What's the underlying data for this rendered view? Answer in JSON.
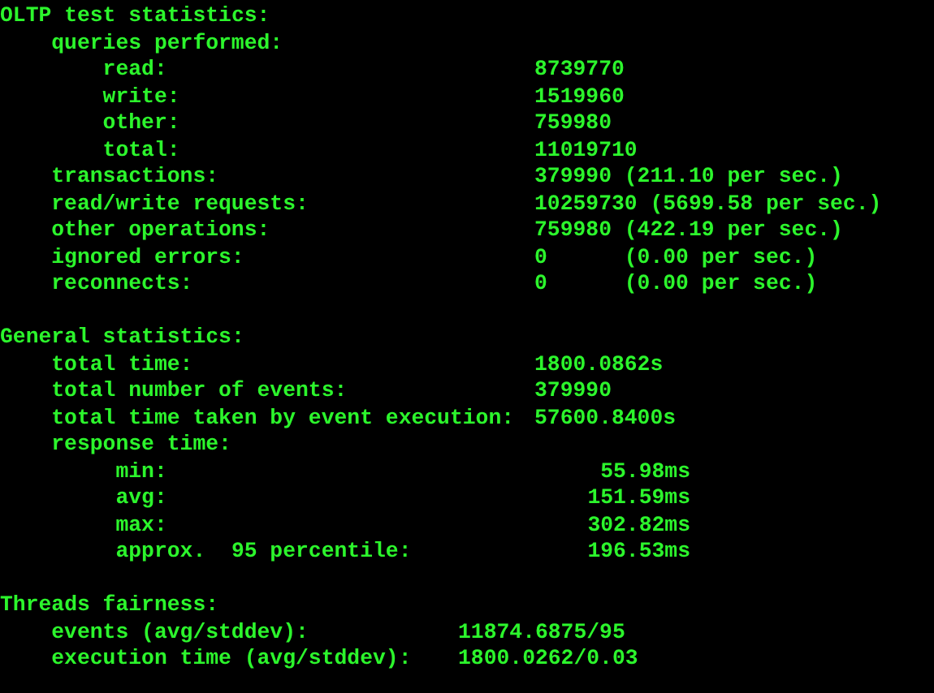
{
  "sections": [
    {
      "kind": "oltp",
      "title": "OLTP test statistics:",
      "items": [
        {
          "label": "queries performed:",
          "children": [
            {
              "label": "read:",
              "value": "8739770"
            },
            {
              "label": "write:",
              "value": "1519960"
            },
            {
              "label": "other:",
              "value": "759980"
            },
            {
              "label": "total:",
              "value": "11019710"
            }
          ]
        },
        {
          "label": "transactions:",
          "value": "379990 (211.10 per sec.)"
        },
        {
          "label": "read/write requests:",
          "value": "10259730 (5699.58 per sec.)"
        },
        {
          "label": "other operations:",
          "value": "759980 (422.19 per sec.)"
        },
        {
          "label": "ignored errors:",
          "value": "0      (0.00 per sec.)"
        },
        {
          "label": "reconnects:",
          "value": "0      (0.00 per sec.)"
        }
      ]
    },
    {
      "kind": "general",
      "title": "General statistics:",
      "items": [
        {
          "label": "total time:",
          "value": "1800.0862s"
        },
        {
          "label": "total number of events:",
          "value": "379990"
        },
        {
          "label": "total time taken by event execution:",
          "value": "57600.8400s"
        },
        {
          "label": "response time:",
          "children": [
            {
              "label": "min:",
              "value": "55.98ms"
            },
            {
              "label": "avg:",
              "value": "151.59ms"
            },
            {
              "label": "max:",
              "value": "302.82ms"
            },
            {
              "label": "approx.  95 percentile:",
              "value": "196.53ms"
            }
          ]
        }
      ]
    },
    {
      "kind": "fairness",
      "title": "Threads fairness:",
      "items": [
        {
          "label": "events (avg/stddev):",
          "value": "11874.6875/95"
        },
        {
          "label": "execution time (avg/stddev):",
          "value": "1800.0262/0.03"
        }
      ]
    }
  ]
}
